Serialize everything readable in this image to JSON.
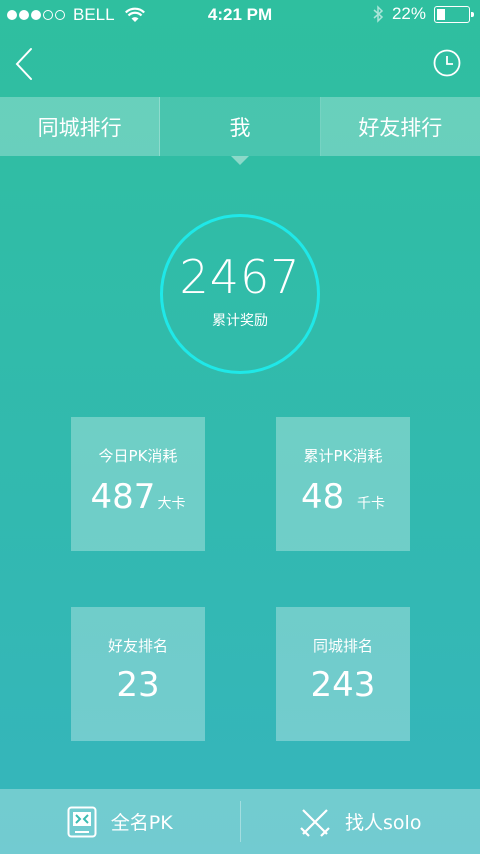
{
  "status": {
    "carrier": "BELL",
    "time": "4:21 PM",
    "battery": "22%",
    "signal_bars": 3
  },
  "nav": {
    "back_icon": "chevron-left-icon",
    "history_icon": "clock-icon"
  },
  "tabs": [
    {
      "label": "同城排行"
    },
    {
      "label": "我"
    },
    {
      "label": "好友排行"
    }
  ],
  "reward": {
    "value": "2467",
    "label": "累计奖励"
  },
  "stats": {
    "today_pk": {
      "title": "今日PK消耗",
      "value": "487",
      "unit": "大卡"
    },
    "total_pk": {
      "title": "累计PK消耗",
      "value": "48",
      "unit": "千卡"
    },
    "friend_rank": {
      "title": "好友排名",
      "value": "23"
    },
    "city_rank": {
      "title": "同城排名",
      "value": "243"
    }
  },
  "bottom": {
    "all_pk": "全名PK",
    "solo": "找人solo"
  },
  "colors": {
    "accent_ring": "#1fe8e8",
    "bg_top": "#2fbf9f",
    "bg_bottom": "#36b5bd"
  }
}
